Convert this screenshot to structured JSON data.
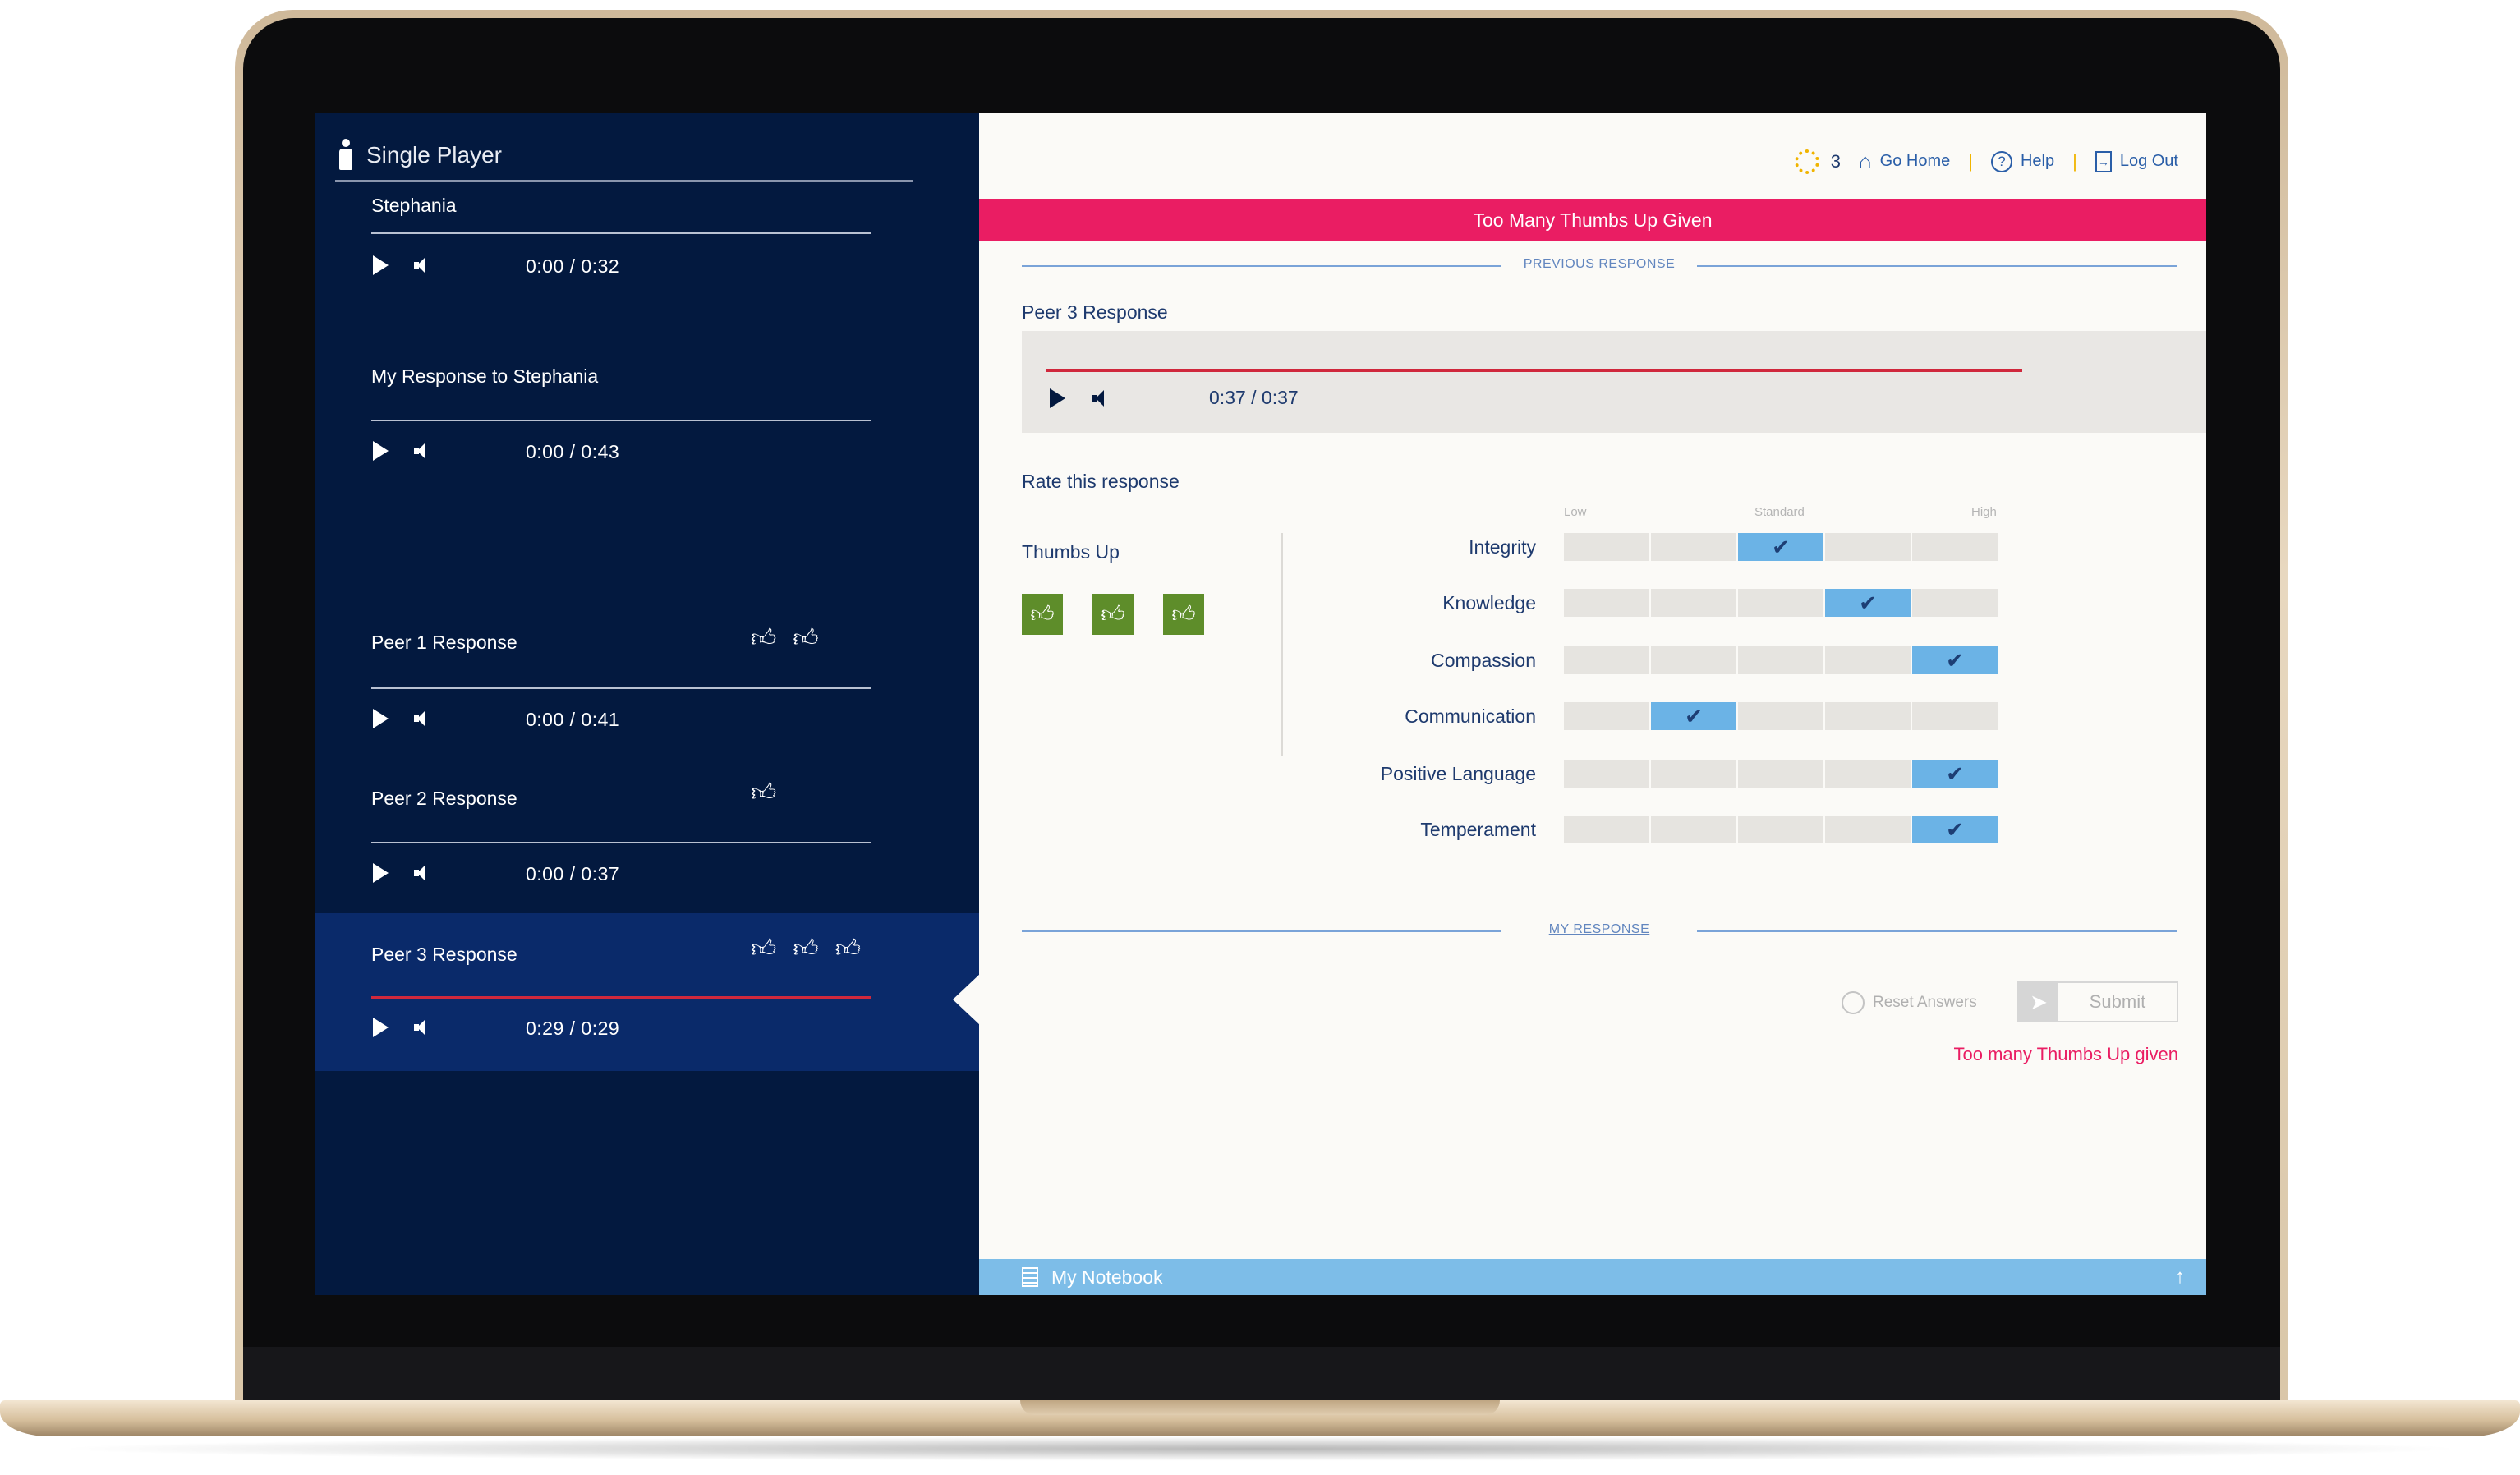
{
  "left_panel": {
    "header": "Single Player",
    "tracks": [
      {
        "title": "Stephania",
        "time": "0:00  /  0:32",
        "thumbs_up": 0
      },
      {
        "title": "My Response to Stephania",
        "time": "0:00  /  0:43",
        "thumbs_up": 0
      },
      {
        "title": "Peer 1 Response",
        "time": "0:00  /  0:41",
        "thumbs_up": 2
      },
      {
        "title": "Peer 2 Response",
        "time": "0:00  /  0:37",
        "thumbs_up": 1
      },
      {
        "title": "Peer 3 Response",
        "time": "0:29  /  0:29",
        "thumbs_up": 3,
        "selected": true
      }
    ]
  },
  "topbar": {
    "count": "3",
    "go_home": "Go Home",
    "help": "Help",
    "log_out": "Log Out"
  },
  "banner": "Too Many Thumbs Up Given",
  "previous_response_link": "PREVIOUS RESPONSE",
  "peer_response": {
    "title": "Peer 3 Response",
    "time": "0:37  /  0:37",
    "progress": 1.0
  },
  "rating": {
    "heading": "Rate this response",
    "thumbs_up_label": "Thumbs Up",
    "thumbs_up_count": 3,
    "scale_labels": {
      "low": "Low",
      "standard": "Standard",
      "high": "High"
    },
    "criteria": [
      {
        "name": "Integrity",
        "level": 3
      },
      {
        "name": "Knowledge",
        "level": 4
      },
      {
        "name": "Compassion",
        "level": 5
      },
      {
        "name": "Communication",
        "level": 2
      },
      {
        "name": "Positive Language",
        "level": 5
      },
      {
        "name": "Temperament",
        "level": 5
      }
    ]
  },
  "my_response_link": "MY RESPONSE",
  "actions": {
    "reset": "Reset Answers",
    "submit": "Submit",
    "error": "Too many Thumbs Up given"
  },
  "notebook": {
    "label": "My Notebook"
  },
  "colors": {
    "navy": "#03193f",
    "selected": "#0a2a6a",
    "banner": "#ea1d63",
    "accent_blue": "#6bb3e6",
    "thumbs_green": "#5e8d2a",
    "progress_red": "#d0283c"
  }
}
